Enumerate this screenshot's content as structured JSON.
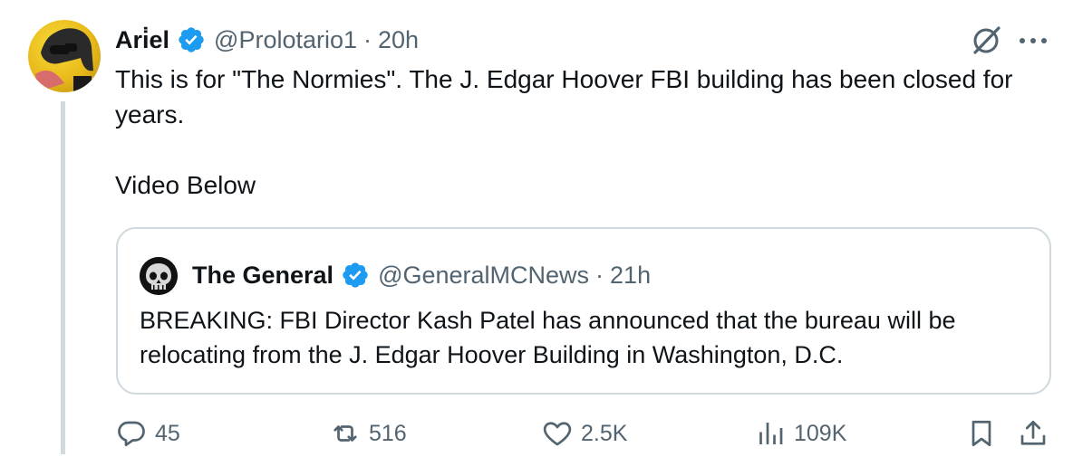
{
  "tweet": {
    "author_name": "Ari̇el",
    "handle": "@Prolotario1",
    "separator": "·",
    "time": "20h",
    "text": "This is for \"The Normies\". The J. Edgar Hoover FBI building has been closed for years.\n\nVideo Below",
    "verified": true
  },
  "quote": {
    "author_name": "The General",
    "handle": "@GeneralMCNews",
    "separator": "·",
    "time": "21h",
    "text": "BREAKING: FBI Director Kash Patel has announced that the bureau will be relocating from the J. Edgar Hoover Building in Washington, D.C.",
    "verified": true
  },
  "actions": {
    "replies": "45",
    "reposts": "516",
    "likes": "2.5K",
    "views": "109K"
  },
  "colors": {
    "verified": "#1d9bf0",
    "muted": "#536471",
    "border": "#cfd9de",
    "text": "#0f1419"
  },
  "icons": {
    "grok": "grok-icon",
    "more": "more-icon",
    "reply": "reply-icon",
    "repost": "repost-icon",
    "like": "heart-icon",
    "views": "views-icon",
    "bookmark": "bookmark-icon",
    "share": "share-icon"
  }
}
